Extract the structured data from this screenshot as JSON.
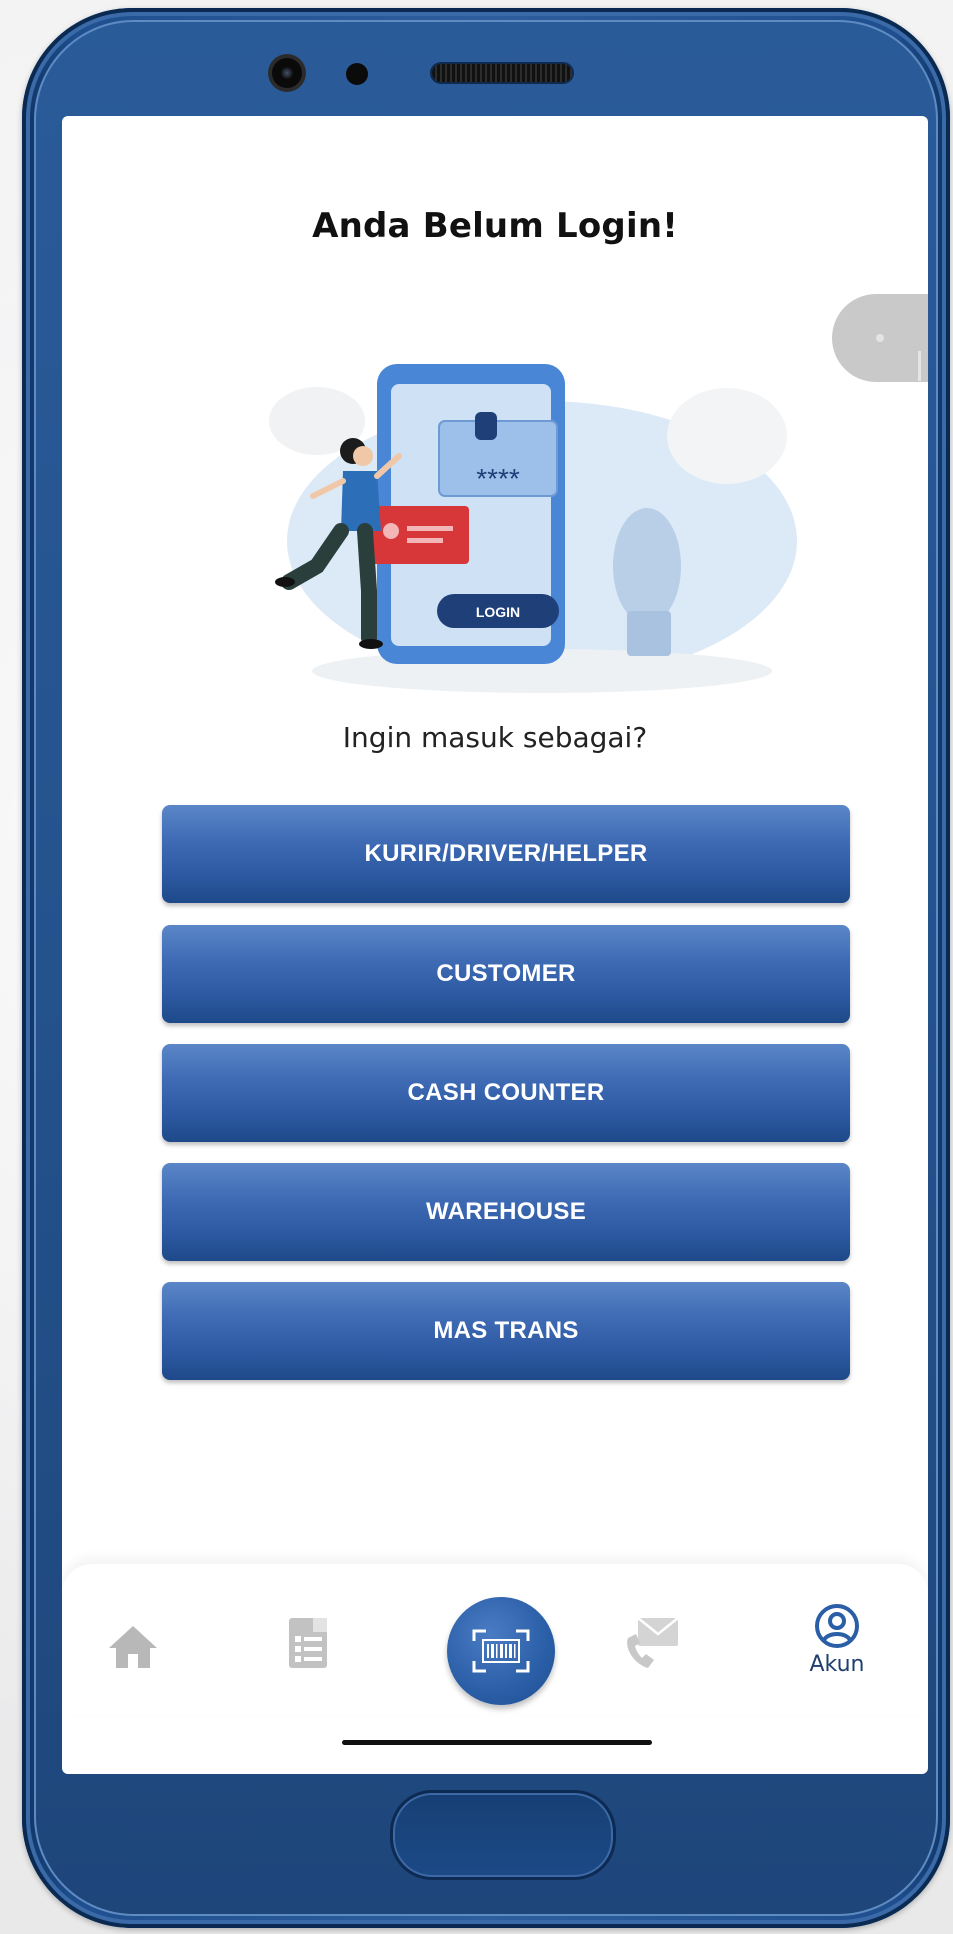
{
  "screen": {
    "title": "Anda Belum Login!",
    "prompt": "Ingin masuk sebagai?",
    "illustration": {
      "password_mask": "****",
      "button_label": "LOGIN"
    }
  },
  "roles": [
    {
      "label": "KURIR/DRIVER/HELPER"
    },
    {
      "label": "CUSTOMER"
    },
    {
      "label": "CASH COUNTER"
    },
    {
      "label": "WAREHOUSE"
    },
    {
      "label": "MAS TRANS"
    }
  ],
  "bottom_nav": {
    "items": [
      {
        "icon": "home-icon"
      },
      {
        "icon": "report-icon"
      },
      {
        "icon": "barcode-scan-icon"
      },
      {
        "icon": "contact-icon"
      },
      {
        "icon": "account-icon",
        "label": "Akun"
      }
    ]
  },
  "colors": {
    "button_top": "#5b86c8",
    "button_bottom": "#1e4989",
    "phone_body": "#2c5e9d",
    "nav_active": "#2a5ea6"
  }
}
